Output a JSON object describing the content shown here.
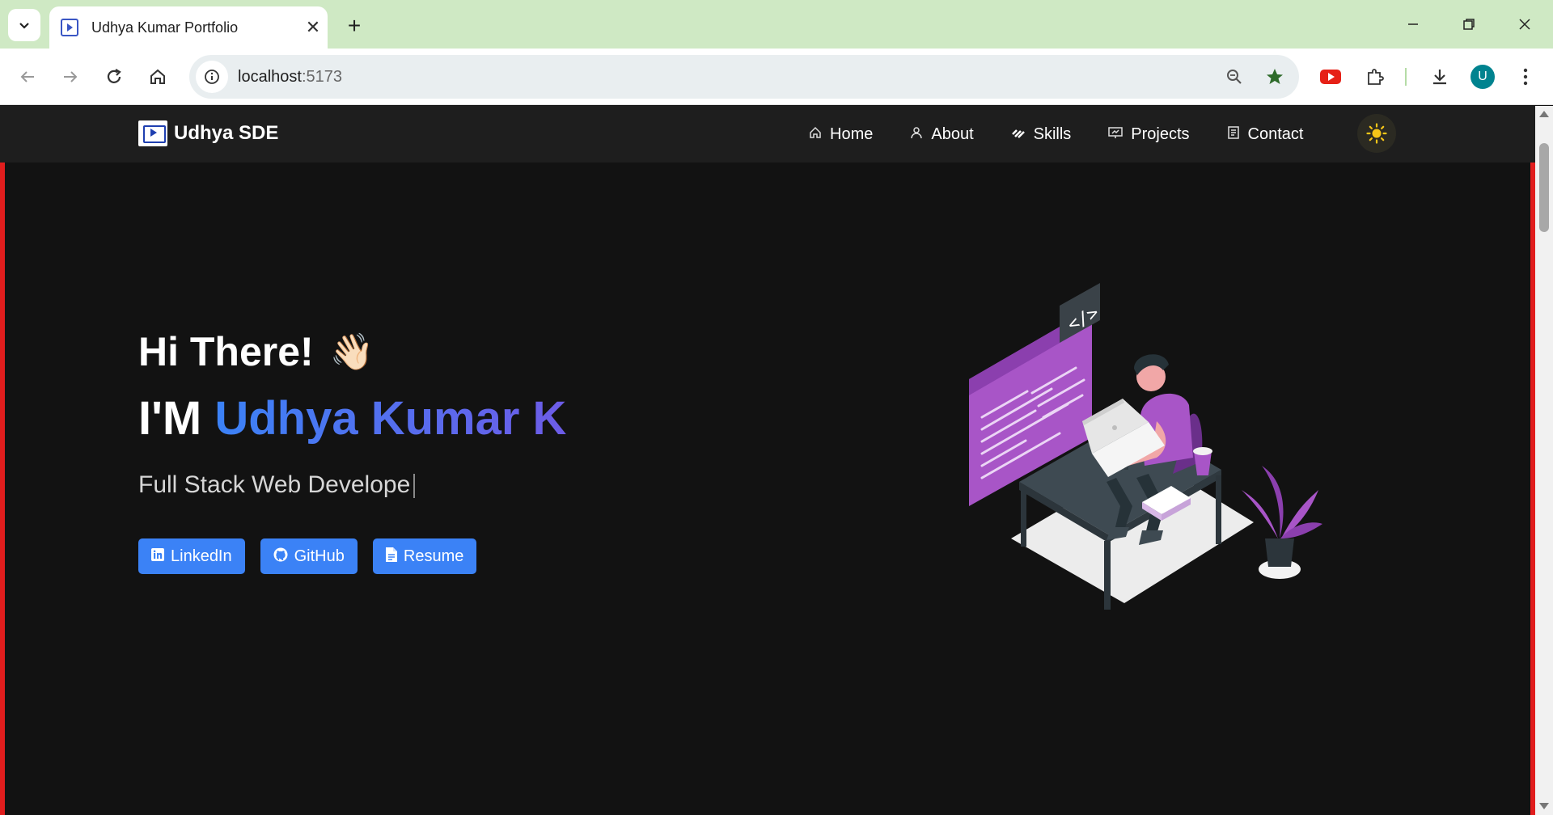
{
  "browser": {
    "tab_title": "Udhya Kumar Portfolio",
    "url_host": "localhost",
    "url_port": ":5173",
    "avatar_letter": "U"
  },
  "navbar": {
    "brand": "Udhya SDE",
    "links": [
      {
        "label": "Home",
        "icon": "home-icon"
      },
      {
        "label": "About",
        "icon": "user-icon"
      },
      {
        "label": "Skills",
        "icon": "skills-icon"
      },
      {
        "label": "Projects",
        "icon": "projects-icon"
      },
      {
        "label": "Contact",
        "icon": "contact-icon"
      }
    ]
  },
  "hero": {
    "greeting": "Hi There!",
    "wave": "👋🏻",
    "name_prefix": "I'M ",
    "name": "Udhya Kumar K",
    "role": "Full Stack Web Develope",
    "buttons": [
      {
        "label": "LinkedIn",
        "icon": "linkedin-icon"
      },
      {
        "label": "GitHub",
        "icon": "github-icon"
      },
      {
        "label": "Resume",
        "icon": "file-icon"
      }
    ]
  },
  "colors": {
    "accent": "#3b82f6",
    "gradient_end": "#6d5ce7",
    "page_bg": "#121212",
    "nav_bg": "#1e1e1e",
    "edge": "#e11d1d",
    "illustration_purple": "#a855c7"
  }
}
